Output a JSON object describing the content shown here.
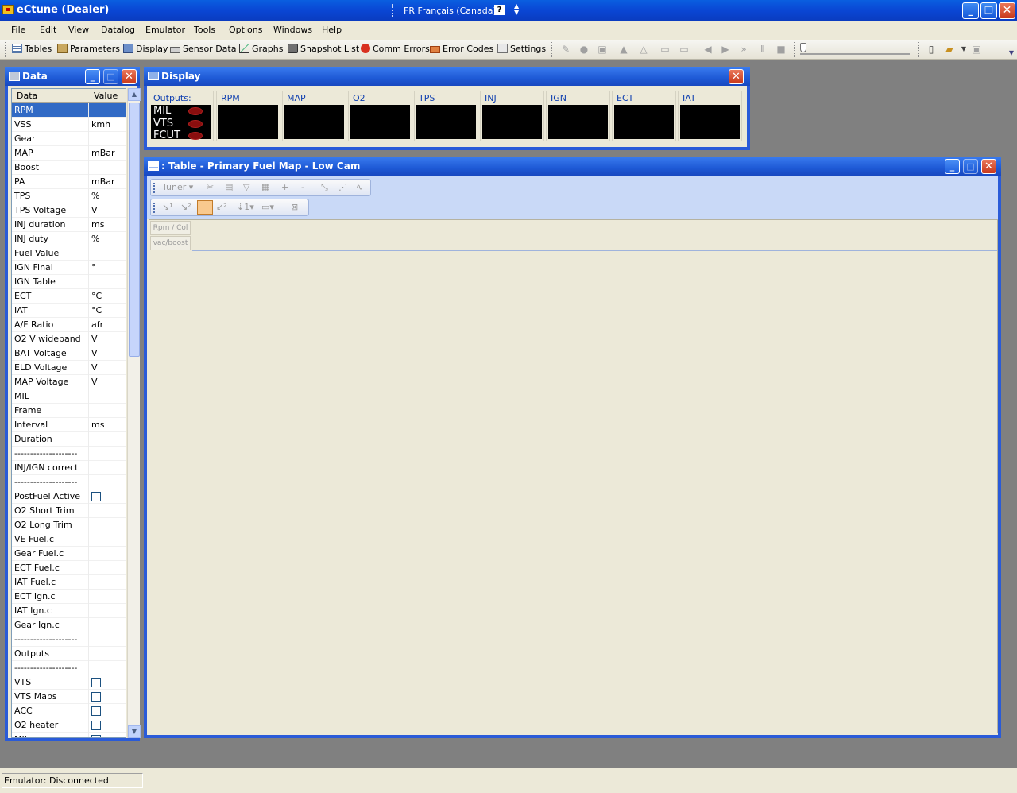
{
  "app": {
    "title": "eCtune (Dealer)",
    "language": "FR Français (Canada)",
    "help_glyph": "?"
  },
  "menu": [
    "File",
    "Edit",
    "View",
    "Datalog",
    "Emulator",
    "Tools",
    "Options",
    "Windows",
    "Help"
  ],
  "toolbar": {
    "tables": "Tables",
    "parameters": "Parameters",
    "display": "Display",
    "sensor_data": "Sensor Data",
    "graphs": "Graphs",
    "snapshot_list": "Snapshot List",
    "comm_errors": "Comm Errors",
    "error_codes": "Error Codes",
    "settings": "Settings"
  },
  "data_panel": {
    "title": "Data",
    "col_data": "Data",
    "col_value": "Value",
    "rows": [
      {
        "label": "RPM",
        "unit": "",
        "checkbox": false,
        "selected": true
      },
      {
        "label": "VSS",
        "unit": "kmh",
        "checkbox": false
      },
      {
        "label": "Gear",
        "unit": "",
        "checkbox": false
      },
      {
        "label": "MAP",
        "unit": "mBar",
        "checkbox": false
      },
      {
        "label": "Boost",
        "unit": "",
        "checkbox": false
      },
      {
        "label": "PA",
        "unit": "mBar",
        "checkbox": false
      },
      {
        "label": "TPS",
        "unit": "%",
        "checkbox": false
      },
      {
        "label": "TPS Voltage",
        "unit": "V",
        "checkbox": false
      },
      {
        "label": "INJ duration",
        "unit": "ms",
        "checkbox": false
      },
      {
        "label": "INJ duty",
        "unit": "%",
        "checkbox": false
      },
      {
        "label": "Fuel Value",
        "unit": "",
        "checkbox": false
      },
      {
        "label": "IGN Final",
        "unit": "°",
        "checkbox": false
      },
      {
        "label": "IGN Table",
        "unit": "",
        "checkbox": false
      },
      {
        "label": "ECT",
        "unit": "°C",
        "checkbox": false
      },
      {
        "label": "IAT",
        "unit": "°C",
        "checkbox": false
      },
      {
        "label": "A/F Ratio",
        "unit": "afr",
        "checkbox": false
      },
      {
        "label": "O2 V wideband",
        "unit": "V",
        "checkbox": false
      },
      {
        "label": "BAT Voltage",
        "unit": "V",
        "checkbox": false
      },
      {
        "label": "ELD Voltage",
        "unit": "V",
        "checkbox": false
      },
      {
        "label": "MAP Voltage",
        "unit": "V",
        "checkbox": false
      },
      {
        "label": "MIL",
        "unit": "",
        "checkbox": false
      },
      {
        "label": "Frame",
        "unit": "",
        "checkbox": false
      },
      {
        "label": "Interval",
        "unit": "ms",
        "checkbox": false
      },
      {
        "label": "Duration",
        "unit": "",
        "checkbox": false
      },
      {
        "label": "--------------------",
        "unit": "",
        "checkbox": false
      },
      {
        "label": "INJ/IGN correct",
        "unit": "",
        "checkbox": false
      },
      {
        "label": "--------------------",
        "unit": "",
        "checkbox": false
      },
      {
        "label": "PostFuel Active",
        "unit": "",
        "checkbox": true
      },
      {
        "label": "O2 Short Trim",
        "unit": "",
        "checkbox": false
      },
      {
        "label": "O2 Long Trim",
        "unit": "",
        "checkbox": false
      },
      {
        "label": "VE Fuel.c",
        "unit": "",
        "checkbox": false
      },
      {
        "label": "Gear Fuel.c",
        "unit": "",
        "checkbox": false
      },
      {
        "label": "ECT Fuel.c",
        "unit": "",
        "checkbox": false
      },
      {
        "label": "IAT Fuel.c",
        "unit": "",
        "checkbox": false
      },
      {
        "label": "ECT Ign.c",
        "unit": "",
        "checkbox": false
      },
      {
        "label": "IAT Ign.c",
        "unit": "",
        "checkbox": false
      },
      {
        "label": "Gear Ign.c",
        "unit": "",
        "checkbox": false
      },
      {
        "label": "--------------------",
        "unit": "",
        "checkbox": false
      },
      {
        "label": "Outputs",
        "unit": "",
        "checkbox": false
      },
      {
        "label": "--------------------",
        "unit": "",
        "checkbox": false
      },
      {
        "label": "VTS",
        "unit": "",
        "checkbox": true
      },
      {
        "label": "VTS Maps",
        "unit": "",
        "checkbox": true
      },
      {
        "label": "ACC",
        "unit": "",
        "checkbox": true
      },
      {
        "label": "O2 heater",
        "unit": "",
        "checkbox": true
      },
      {
        "label": "MIL",
        "unit": "",
        "checkbox": true
      }
    ]
  },
  "display_panel": {
    "title": "Display",
    "outputs_label": "Outputs:",
    "outputs": [
      "MIL",
      "VTS",
      "FCUT"
    ],
    "gauges": [
      "RPM",
      "MAP",
      "O2",
      "TPS",
      "INJ",
      "IGN",
      "ECT",
      "IAT"
    ]
  },
  "table_panel": {
    "title": ": Table - Primary Fuel Map - Low Cam",
    "tuner_label": "Tuner",
    "row_header_1": "Rpm / Col",
    "row_header_2": "vac/boost"
  },
  "status": {
    "emulator": "Emulator: Disconnected"
  },
  "colors": {
    "titlebar": "#0a46d4",
    "panel_border": "#2a5bd8",
    "selection": "#316ac5",
    "led": "#8a0e0e"
  }
}
